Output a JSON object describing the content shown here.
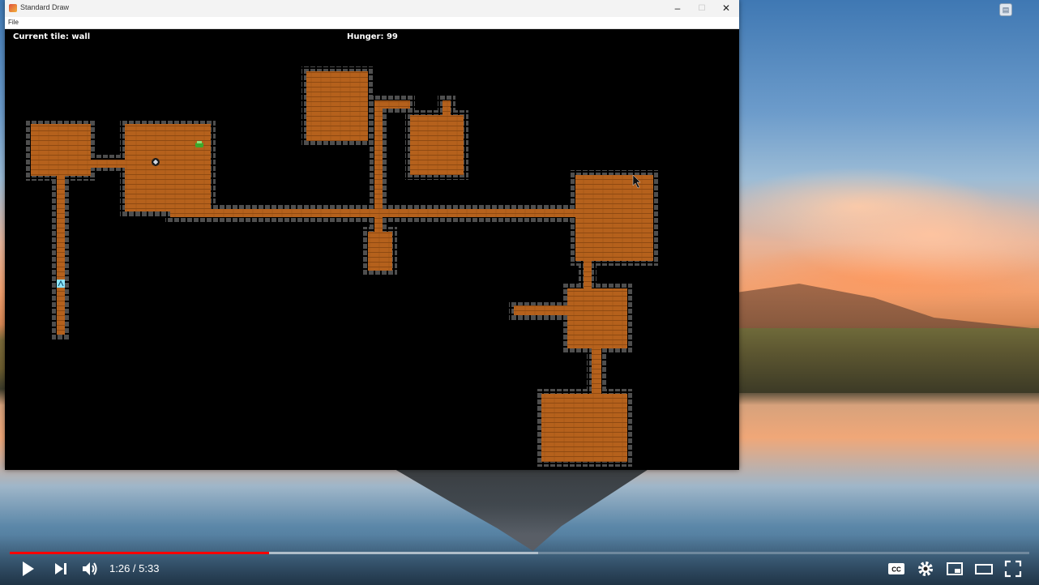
{
  "window": {
    "title": "Standard Draw",
    "menu": [
      "File"
    ]
  },
  "hud": {
    "current_tile": "Current tile: wall",
    "hunger": "Hunger: 99"
  },
  "player": {
    "current_time": "1:26",
    "separator": " / ",
    "duration": "5:33",
    "played_fraction": 0.254,
    "buffered_fraction": 0.518
  },
  "colors": {
    "floor": "#b5611c",
    "wall": "#4e4e4e",
    "background": "#000000",
    "progress": "#ff0000"
  },
  "icons": {
    "play": "play-icon",
    "next": "next-icon",
    "volume": "volume-icon",
    "cc": "captions-icon",
    "settings": "gear-icon",
    "miniplayer": "miniplayer-icon",
    "theater": "theater-icon",
    "fullscreen": "fullscreen-icon"
  }
}
